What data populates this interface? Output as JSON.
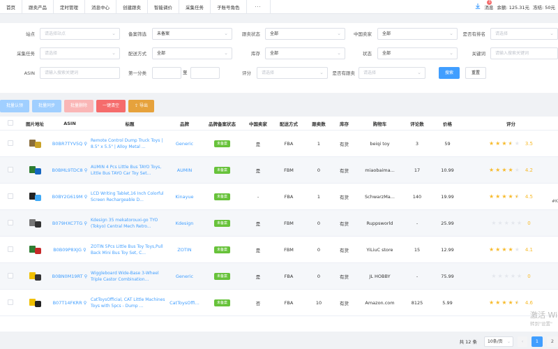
{
  "nav": {
    "tabs": [
      "首页",
      "跟卖产品",
      "定时管理",
      "消息中心",
      "创建跟卖",
      "智能调价",
      "采集任务",
      "子账号角色",
      "···"
    ],
    "download_icon": "download-icon",
    "messages_label": "消息",
    "message_badge": "5",
    "balance": "余额: 125.31元",
    "extra": "冻结: 50元"
  },
  "filters": {
    "row1": {
      "site_label": "站点",
      "site_placeholder": "请选择站点",
      "brand_label": "备案筛选",
      "brand_value": "未备案",
      "follow_label": "跟卖状态",
      "follow_value": "全部",
      "cn_label": "中国卖家",
      "cn_value": "全部",
      "rank_label": "是否有排名",
      "rank_placeholder": "请选择"
    },
    "row2": {
      "task_label": "采集任务",
      "task_placeholder": "请选择",
      "ship_label": "配送方式",
      "ship_value": "全部",
      "stock_label": "库存",
      "stock_value": "全部",
      "status_label": "状态",
      "status_value": "全部",
      "kw_label": "关键词",
      "kw_placeholder": "请输入搜索关键词"
    },
    "row3": {
      "asin_label": "ASIN",
      "asin_placeholder": "请输入搜索关键词",
      "cat_label": "第一分类",
      "range_sep": "至",
      "score_label": "评分",
      "score_placeholder": "请选择",
      "has_follow_label": "是否有跟卖",
      "has_follow_placeholder": "请选择",
      "search_btn": "搜索",
      "reset_btn": "重置"
    }
  },
  "actions": [
    "批量认领",
    "批量同步",
    "批量删除",
    "一键清空",
    "导出"
  ],
  "table": {
    "headers": [
      "图片地址",
      "ASIN",
      "标题",
      "品牌",
      "品牌备案状态",
      "中国卖家",
      "配送方式",
      "跟卖数",
      "库存",
      "购物车",
      "评论数",
      "价格",
      "评分"
    ],
    "rows": [
      {
        "asin": "B0BR7TYV5Q",
        "title": "Remote Control Dump Truck Toys | 8.5\" x 5.5\" | Alloy Metal ...",
        "brand": "Generic",
        "status": "未备案",
        "cn": "是",
        "ship": "FBA",
        "follow": "1",
        "stock": "有货",
        "cart": "beiqi toy",
        "reviews": "3",
        "price": "59",
        "rating": "3.5",
        "stars": [
          1,
          1,
          1,
          0.5,
          0
        ]
      },
      {
        "asin": "B0BML9TDC8",
        "title": "AUMIN 4 Pcs Little Bus TAYO Toys, Little Bus TAYO Car Toy Set...",
        "brand": "AUMIN",
        "status": "未备案",
        "cn": "是",
        "ship": "FBM",
        "follow": "0",
        "stock": "有货",
        "cart": "miaobaima...",
        "reviews": "17",
        "price": "10.99",
        "rating": "4.2",
        "stars": [
          1,
          1,
          1,
          1,
          0
        ]
      },
      {
        "asin": "B0BY2G619M",
        "title": "LCD Writing Tablet,16 Inch Colorful Screen Rechargeable D...",
        "brand": "Kinayue",
        "status": "未备案",
        "cn": "-",
        "ship": "FBA",
        "follow": "1",
        "stock": "有货",
        "cart": "SchwarzMa...",
        "reviews": "140",
        "price": "19.99",
        "rating": "4.5",
        "stars": [
          1,
          1,
          1,
          1,
          0.5
        ]
      },
      {
        "asin": "B079HXC7TG",
        "title": "Kdesign 35 mekatorouxi-go TYO (Tokyo) Central Mech Retro...",
        "brand": "Kdesign",
        "status": "未备案",
        "cn": "是",
        "ship": "FBM",
        "follow": "0",
        "stock": "有货",
        "cart": "Ruppsworld",
        "reviews": "-",
        "price": "25.99",
        "rating": "0",
        "stars": [
          0,
          0,
          0,
          0,
          0
        ]
      },
      {
        "asin": "B0B09P8XJG",
        "title": "ZOTIN 5Pcs Little Bus Toy Toys,Pull Back Mini Bus Toy Set, C...",
        "brand": "ZOTIN",
        "status": "未备案",
        "cn": "是",
        "ship": "FBM",
        "follow": "0",
        "stock": "有货",
        "cart": "YiLiuC store",
        "reviews": "15",
        "price": "12.99",
        "rating": "4.1",
        "stars": [
          1,
          1,
          1,
          1,
          0
        ]
      },
      {
        "asin": "B0BN0M19RT",
        "title": "Wiggleboard Wide-Base 3-Wheel Triple Castor Combination...",
        "brand": "Generic",
        "status": "未备案",
        "cn": "是",
        "ship": "FBA",
        "follow": "0",
        "stock": "有货",
        "cart": "JL HOBBY",
        "reviews": "-",
        "price": "75.99",
        "rating": "0",
        "stars": [
          0,
          0,
          0,
          0,
          0
        ]
      },
      {
        "asin": "B07T14FKRR",
        "title": "CatToysOfficial, CAT Little Machines Toys with 5pcs - Dump ...",
        "brand": "CatToysOffi...",
        "status": "未备案",
        "cn": "否",
        "ship": "FBA",
        "follow": "10",
        "stock": "有货",
        "cart": "Amazon.com",
        "reviews": "8125",
        "price": "5.99",
        "rating": "4.6",
        "stars": [
          1,
          1,
          1,
          1,
          0.5
        ]
      }
    ],
    "peek_text": "#K"
  },
  "pager": {
    "total": "共 12 条",
    "page_size": "10条/页",
    "pages": [
      "1",
      "2"
    ]
  },
  "watermark": {
    "line1": "激活 Wi",
    "line2": "转到\"设置\""
  },
  "colors": {
    "primary": "#409eff",
    "success": "#67c23a",
    "danger": "#f56c6c",
    "warning": "#e6a23c",
    "star": "#f7ba2a"
  }
}
